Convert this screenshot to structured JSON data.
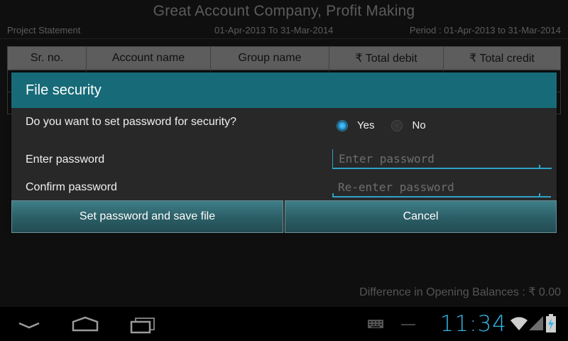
{
  "app": {
    "company_title": "Great Account Company, Profit Making",
    "report_name": "Project Statement",
    "date_range": "01-Apr-2013 To 31-Mar-2014",
    "period": "Period : 01-Apr-2013 to 31-Mar-2014",
    "table": {
      "columns": [
        "Sr. no.",
        "Account name",
        "Group name",
        "₹ Total debit",
        "₹ Total credit"
      ]
    },
    "difference_text": "Difference in Opening Balances : ₹ 0.00"
  },
  "dialog": {
    "title": "File security",
    "question": "Do you want to set password for security?",
    "yes_label": "Yes",
    "no_label": "No",
    "selected": "Yes",
    "password_label": "Enter password",
    "password_placeholder": "Enter password",
    "password_value": "",
    "confirm_label": "Confirm password",
    "confirm_placeholder": "Re-enter password",
    "confirm_value": "",
    "primary_button": "Set password and save file",
    "cancel_button": "Cancel"
  },
  "system_bar": {
    "time": "11:34",
    "accent_color": "#33b5e5"
  },
  "colors": {
    "dialog_title_bg": "#176b78",
    "button_bg": "#2b5d65",
    "radio_selected": "#33b5e5"
  }
}
